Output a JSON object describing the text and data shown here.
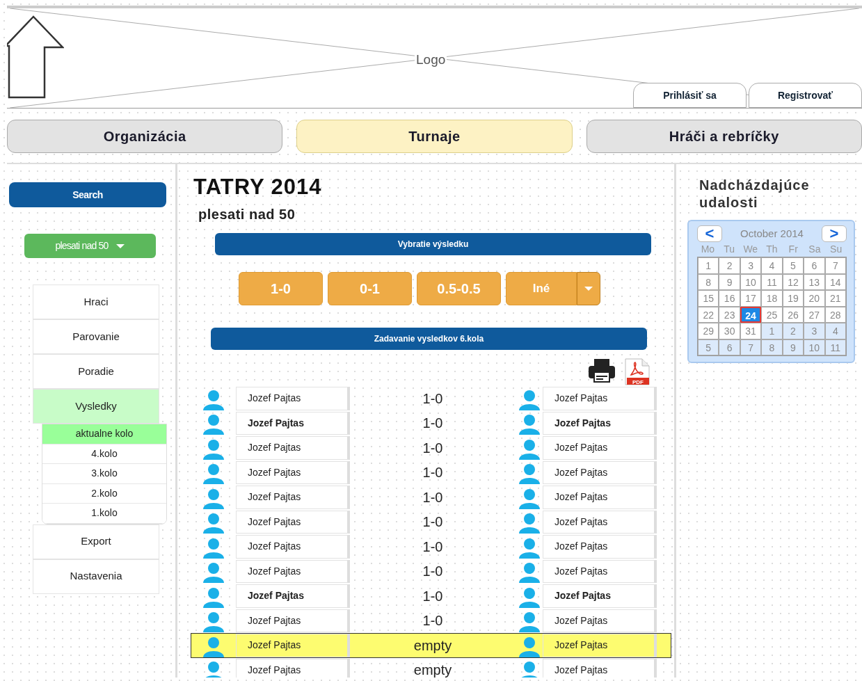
{
  "header": {
    "logo": "Logo",
    "buttons": [
      "Prihlásiť sa",
      "Registrovať"
    ]
  },
  "nav": [
    {
      "label": "Organizácia",
      "selected": false
    },
    {
      "label": "Turnaje",
      "selected": true
    },
    {
      "label": "Hráči a rebríčky",
      "selected": false
    }
  ],
  "sidebar": {
    "search": "Search",
    "category": "plesati nad 50",
    "menu": [
      {
        "label": "Hraci",
        "selected": false
      },
      {
        "label": "Parovanie",
        "selected": false
      },
      {
        "label": "Poradie",
        "selected": false
      },
      {
        "label": "Vysledky",
        "selected": true,
        "children": [
          {
            "label": "aktualne kolo",
            "selected": true
          },
          {
            "label": "4.kolo",
            "selected": false
          },
          {
            "label": "3.kolo",
            "selected": false
          },
          {
            "label": "2.kolo",
            "selected": false
          },
          {
            "label": "1.kolo",
            "selected": false
          }
        ]
      },
      {
        "label": "Export",
        "selected": false
      },
      {
        "label": "Nastavenia",
        "selected": false
      }
    ]
  },
  "main": {
    "title": "TATRY 2014",
    "subtitle": "plesati nad 50",
    "result_header": "Vybratie výsledku",
    "result_buttons": [
      {
        "label": "1-0",
        "kind": "button"
      },
      {
        "label": "0-1",
        "kind": "button"
      },
      {
        "label": "0.5-0.5",
        "kind": "button"
      },
      {
        "label": "Iné",
        "kind": "split"
      }
    ],
    "rounds_header": "Zadavanie vysledkov 6.kola",
    "pdf_icon_text": "PDF",
    "games": [
      {
        "white": "Jozef Pajtas",
        "result": "1-0",
        "black": "Jozef Pajtas",
        "bold": false,
        "selected": false
      },
      {
        "white": "Jozef Pajtas",
        "result": "1-0",
        "black": "Jozef Pajtas",
        "bold": true,
        "selected": false
      },
      {
        "white": "Jozef Pajtas",
        "result": "1-0",
        "black": "Jozef Pajtas",
        "bold": false,
        "selected": false
      },
      {
        "white": "Jozef Pajtas",
        "result": "1-0",
        "black": "Jozef Pajtas",
        "bold": false,
        "selected": false
      },
      {
        "white": "Jozef Pajtas",
        "result": "1-0",
        "black": "Jozef Pajtas",
        "bold": false,
        "selected": false
      },
      {
        "white": "Jozef Pajtas",
        "result": "1-0",
        "black": "Jozef Pajtas",
        "bold": false,
        "selected": false
      },
      {
        "white": "Jozef Pajtas",
        "result": "1-0",
        "black": "Jozef Pajtas",
        "bold": false,
        "selected": false
      },
      {
        "white": "Jozef Pajtas",
        "result": "1-0",
        "black": "Jozef Pajtas",
        "bold": false,
        "selected": false
      },
      {
        "white": "Jozef Pajtas",
        "result": "1-0",
        "black": "Jozef Pajtas",
        "bold": true,
        "selected": false
      },
      {
        "white": "Jozef Pajtas",
        "result": "1-0",
        "black": "Jozef Pajtas",
        "bold": false,
        "selected": false
      },
      {
        "white": "Jozef Pajtas",
        "result": "empty",
        "black": "Jozef Pajtas",
        "bold": false,
        "selected": true
      },
      {
        "white": "Jozef Pajtas",
        "result": "empty",
        "black": "Jozef Pajtas",
        "bold": false,
        "selected": false
      }
    ]
  },
  "events": {
    "title": "Nadcházdajúce udalosti",
    "calendar": {
      "prev": "<",
      "next": ">",
      "month": "October 2014",
      "weekdays": [
        "Mo",
        "Tu",
        "We",
        "Th",
        "Fr",
        "Sa",
        "Su"
      ],
      "weeks": [
        {
          "days": [
            {
              "day": "1",
              "outside": false,
              "selected": false
            },
            {
              "day": "2",
              "outside": false,
              "selected": false
            },
            {
              "day": "3",
              "outside": false,
              "selected": false
            },
            {
              "day": "4",
              "outside": false,
              "selected": false
            },
            {
              "day": "5",
              "outside": false,
              "selected": false
            },
            {
              "day": "6",
              "outside": false,
              "selected": false
            },
            {
              "day": "7",
              "outside": false,
              "selected": false
            }
          ]
        },
        {
          "days": [
            {
              "day": "8",
              "outside": false,
              "selected": false
            },
            {
              "day": "9",
              "outside": false,
              "selected": false
            },
            {
              "day": "10",
              "outside": false,
              "selected": false
            },
            {
              "day": "11",
              "outside": false,
              "selected": false
            },
            {
              "day": "12",
              "outside": false,
              "selected": false
            },
            {
              "day": "13",
              "outside": false,
              "selected": false
            },
            {
              "day": "14",
              "outside": false,
              "selected": false
            }
          ]
        },
        {
          "days": [
            {
              "day": "15",
              "outside": false,
              "selected": false
            },
            {
              "day": "16",
              "outside": false,
              "selected": false
            },
            {
              "day": "17",
              "outside": false,
              "selected": false
            },
            {
              "day": "18",
              "outside": false,
              "selected": false
            },
            {
              "day": "19",
              "outside": false,
              "selected": false
            },
            {
              "day": "20",
              "outside": false,
              "selected": false
            },
            {
              "day": "21",
              "outside": false,
              "selected": false
            }
          ]
        },
        {
          "days": [
            {
              "day": "22",
              "outside": false,
              "selected": false
            },
            {
              "day": "23",
              "outside": false,
              "selected": false
            },
            {
              "day": "24",
              "outside": false,
              "selected": true
            },
            {
              "day": "25",
              "outside": false,
              "selected": false
            },
            {
              "day": "26",
              "outside": false,
              "selected": false
            },
            {
              "day": "27",
              "outside": false,
              "selected": false
            },
            {
              "day": "28",
              "outside": false,
              "selected": false
            }
          ]
        },
        {
          "days": [
            {
              "day": "29",
              "outside": false,
              "selected": false
            },
            {
              "day": "30",
              "outside": false,
              "selected": false
            },
            {
              "day": "31",
              "outside": false,
              "selected": false
            },
            {
              "day": "1",
              "outside": true,
              "selected": false
            },
            {
              "day": "2",
              "outside": true,
              "selected": false
            },
            {
              "day": "3",
              "outside": true,
              "selected": false
            },
            {
              "day": "4",
              "outside": true,
              "selected": false
            }
          ]
        },
        {
          "days": [
            {
              "day": "5",
              "outside": true,
              "selected": false
            },
            {
              "day": "6",
              "outside": true,
              "selected": false
            },
            {
              "day": "7",
              "outside": true,
              "selected": false
            },
            {
              "day": "8",
              "outside": true,
              "selected": false
            },
            {
              "day": "9",
              "outside": true,
              "selected": false
            },
            {
              "day": "10",
              "outside": true,
              "selected": false
            },
            {
              "day": "11",
              "outside": true,
              "selected": false
            }
          ]
        }
      ]
    }
  }
}
